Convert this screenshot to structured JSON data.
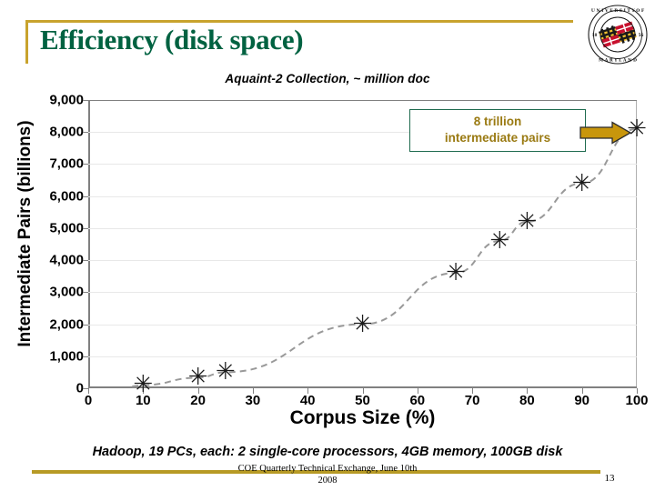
{
  "slide": {
    "title": "Efficiency (disk space)",
    "subtitle": "Aquaint-2 Collection, ~ million doc",
    "logo_alt": "University of Maryland seal",
    "accent_gold": "#C8A32D",
    "title_green": "#006241"
  },
  "callout": {
    "line1": "8 trillion",
    "line2": "intermediate pairs",
    "border_color": "#1F6B4F",
    "text_color": "#9A7A12",
    "arrow_color": "#C8960C"
  },
  "footer": {
    "note": "Hadoop, 19 PCs, each: 2 single-core processors, 4GB memory,  100GB disk",
    "conference_line1": "COE Quarterly Technical Exchange, June 10th",
    "conference_line2": "2008",
    "page_number": "13",
    "rule_color": "#B79A25"
  },
  "chart_data": {
    "type": "scatter",
    "title": "",
    "subtitle": "Aquaint-2 Collection, ~ million doc",
    "xlabel": "Corpus Size (%)",
    "ylabel": "Intermediate Pairs (billions)",
    "xlim": [
      0,
      100
    ],
    "ylim": [
      0,
      9000
    ],
    "xticks": [
      0,
      10,
      20,
      30,
      40,
      50,
      60,
      70,
      80,
      90,
      100
    ],
    "xtick_labels": [
      "0",
      "10",
      "20",
      "30",
      "40",
      "50",
      "60",
      "70",
      "80",
      "90",
      "100"
    ],
    "yticks": [
      0,
      1000,
      2000,
      3000,
      4000,
      5000,
      6000,
      7000,
      8000,
      9000
    ],
    "ytick_labels": [
      "0",
      "1,000",
      "2,000",
      "3,000",
      "4,000",
      "5,000",
      "6,000",
      "7,000",
      "8,000",
      "9,000"
    ],
    "grid": "horizontal",
    "legend": "none",
    "marker": "asterisk",
    "marker_color": "#1a1a1a",
    "trendline": {
      "style": "dashed",
      "color": "#999999"
    },
    "series": [
      {
        "name": "Intermediate Pairs",
        "points": [
          {
            "x": 10,
            "y": 100
          },
          {
            "x": 20,
            "y": 330
          },
          {
            "x": 25,
            "y": 500
          },
          {
            "x": 50,
            "y": 2000
          },
          {
            "x": 67,
            "y": 3600
          },
          {
            "x": 75,
            "y": 4600
          },
          {
            "x": 80,
            "y": 5200
          },
          {
            "x": 90,
            "y": 6400
          },
          {
            "x": 100,
            "y": 8100
          }
        ]
      }
    ],
    "annotations": [
      {
        "text": "8 trillion intermediate pairs",
        "points_to": {
          "x": 100,
          "y": 8100
        }
      }
    ]
  }
}
